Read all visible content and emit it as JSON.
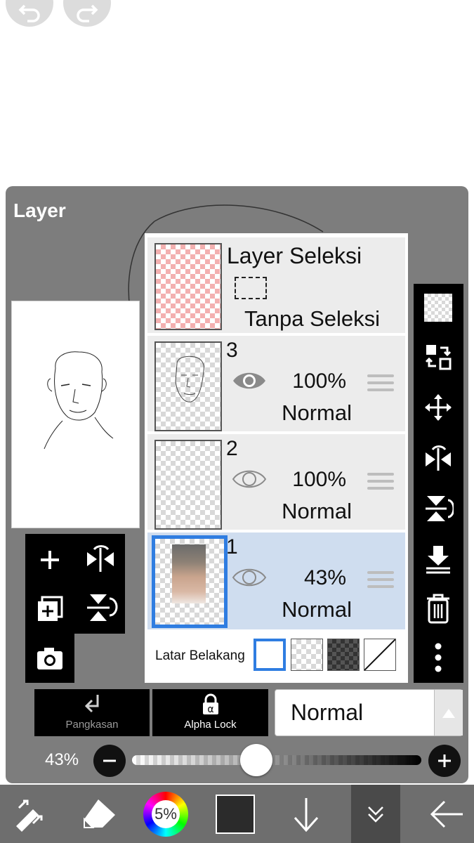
{
  "panel": {
    "title": "Layer"
  },
  "layers": [
    {
      "name": "Layer Seleksi",
      "status": "Tanpa Seleksi"
    },
    {
      "number": "3",
      "opacity": "100%",
      "blend": "Normal"
    },
    {
      "number": "2",
      "opacity": "100%",
      "blend": "Normal"
    },
    {
      "number": "1",
      "opacity": "43%",
      "blend": "Normal",
      "selected": true
    }
  ],
  "background": {
    "label": "Latar Belakang"
  },
  "actions": {
    "clip_label": "Pangkasan",
    "alpha_lock_label": "Alpha Lock",
    "blend_mode": "Normal"
  },
  "opacity": {
    "value_label": "43%",
    "value": 0.43
  },
  "toolbar": {
    "color_wheel_label": "5%",
    "current_color": "#2b2b2b"
  },
  "colors": {
    "accent": "#2f7de1",
    "selected_row": "#cfddef"
  }
}
